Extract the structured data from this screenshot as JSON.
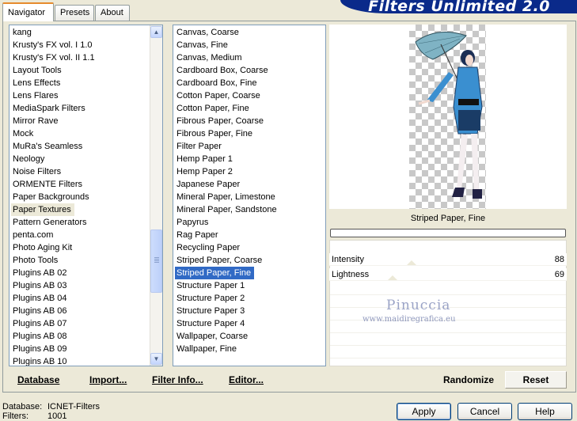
{
  "banner_title": "Filters Unlimited 2.0",
  "tabs": [
    {
      "label": "Navigator",
      "active": true
    },
    {
      "label": "Presets",
      "active": false
    },
    {
      "label": "About",
      "active": false
    }
  ],
  "categories": [
    "kang",
    "Krusty's FX vol. I 1.0",
    "Krusty's FX vol. II 1.1",
    "Layout Tools",
    "Lens Effects",
    "Lens Flares",
    "MediaSpark Filters",
    "Mirror Rave",
    "Mock",
    "MuRa's Seamless",
    "Neology",
    "Noise Filters",
    "ORMENTE Filters",
    "Paper Backgrounds",
    "Paper Textures",
    "Pattern Generators",
    "penta.com",
    "Photo Aging Kit",
    "Photo Tools",
    "Plugins AB 02",
    "Plugins AB 03",
    "Plugins AB 04",
    "Plugins AB 06",
    "Plugins AB 07",
    "Plugins AB 08",
    "Plugins AB 09",
    "Plugins AB 10"
  ],
  "selected_category": "Paper Textures",
  "filters": [
    "Canvas, Coarse",
    "Canvas, Fine",
    "Canvas, Medium",
    "Cardboard Box, Coarse",
    "Cardboard Box, Fine",
    "Cotton Paper, Coarse",
    "Cotton Paper, Fine",
    "Fibrous Paper, Coarse",
    "Fibrous Paper, Fine",
    "Filter Paper",
    "Hemp Paper 1",
    "Hemp Paper 2",
    "Japanese Paper",
    "Mineral Paper, Limestone",
    "Mineral Paper, Sandstone",
    "Papyrus",
    "Rag Paper",
    "Recycling Paper",
    "Striped Paper, Coarse",
    "Striped Paper, Fine",
    "Structure Paper 1",
    "Structure Paper 2",
    "Structure Paper 3",
    "Structure Paper 4",
    "Wallpaper, Coarse",
    "Wallpaper, Fine"
  ],
  "selected_filter": "Striped Paper, Fine",
  "preview_caption": "Striped Paper, Fine",
  "params": [
    {
      "name": "Intensity",
      "value": "88"
    },
    {
      "name": "Lightness",
      "value": "69"
    }
  ],
  "watermark": {
    "name": "Pinuccia",
    "url": "www.maidiregrafica.eu"
  },
  "nav_buttons": {
    "database": "Database",
    "import": "Import...",
    "filter_info": "Filter Info...",
    "editor": "Editor..."
  },
  "randomize_label": "Randomize",
  "reset_label": "Reset",
  "status": {
    "database_label": "Database:",
    "database_value": "ICNET-Filters",
    "filters_label": "Filters:",
    "filters_value": "1001"
  },
  "dialog_buttons": {
    "apply": "Apply",
    "cancel": "Cancel",
    "help": "Help"
  }
}
